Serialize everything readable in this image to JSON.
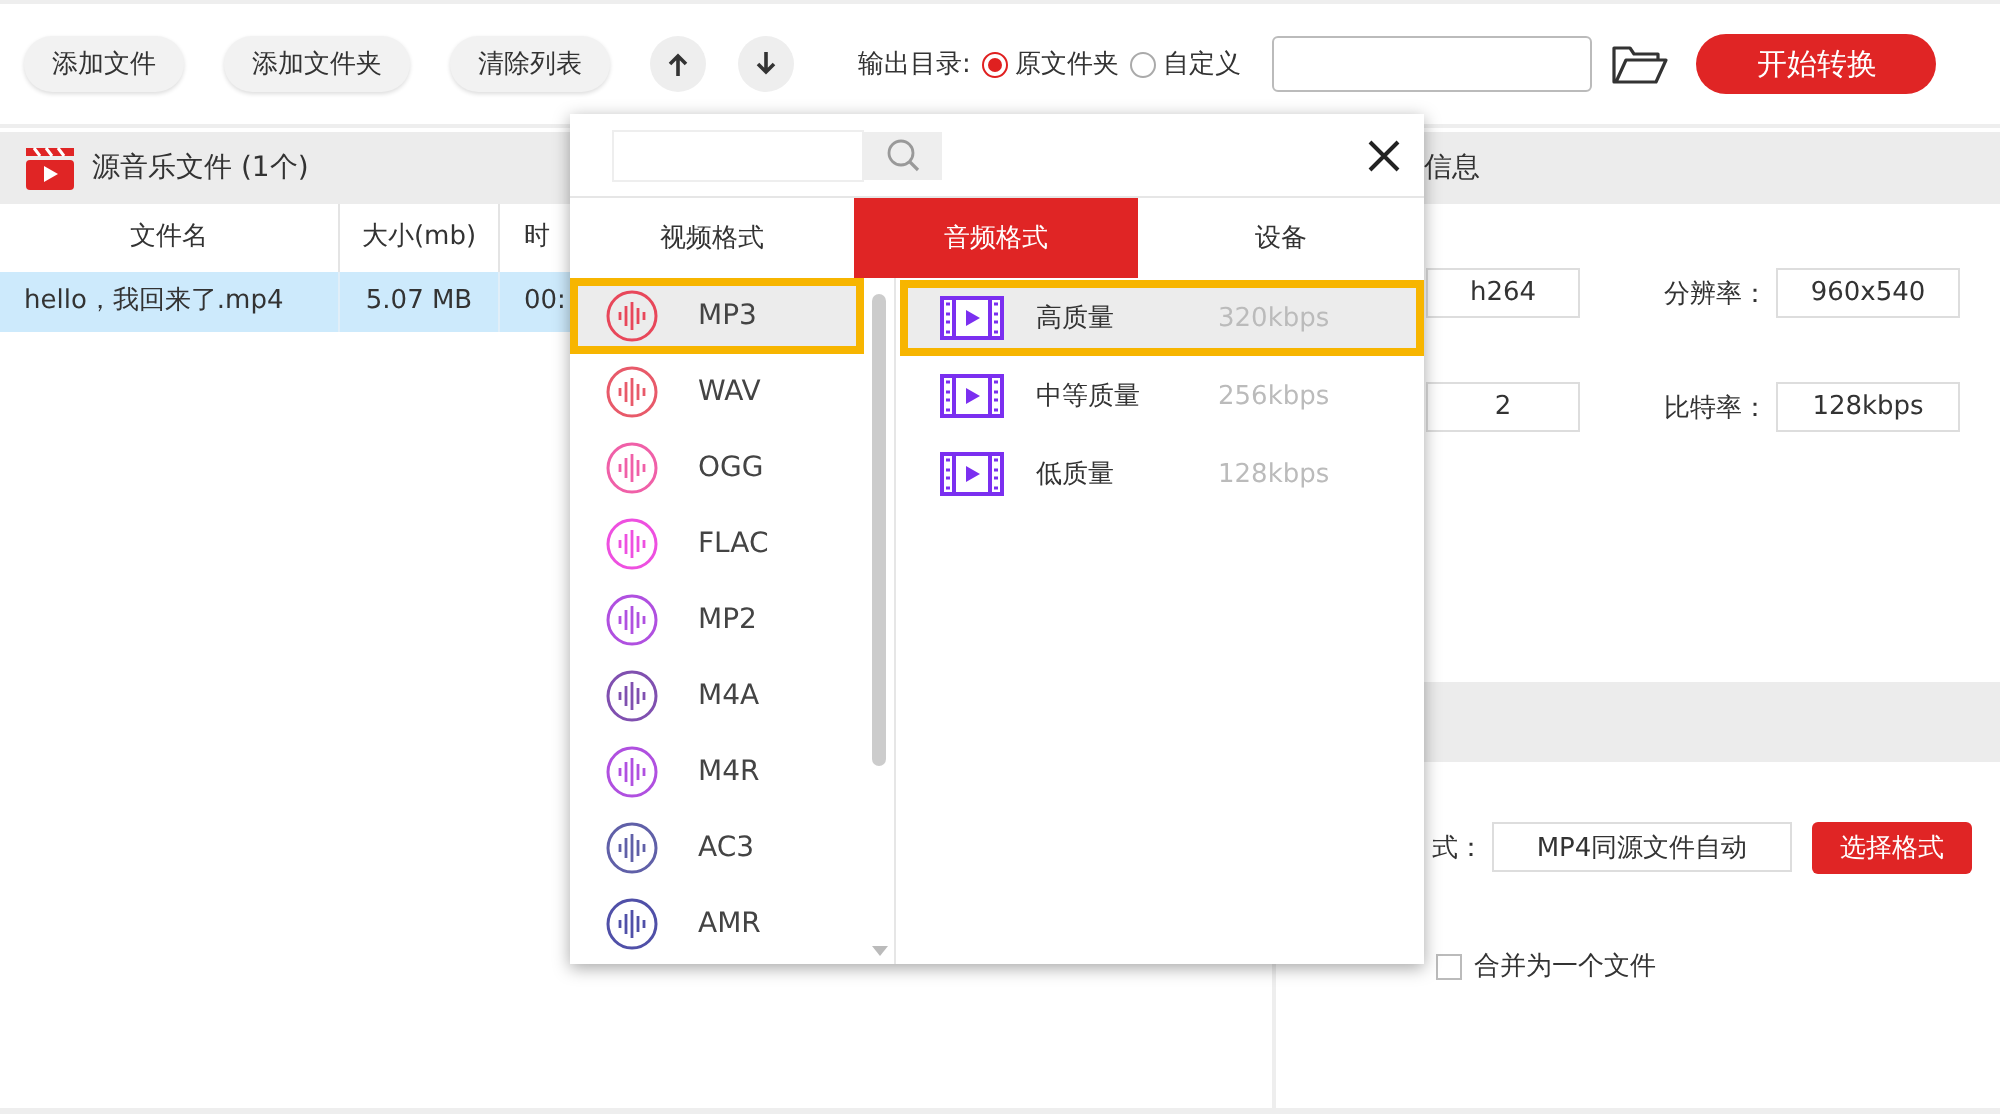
{
  "toolbar": {
    "buttons": [
      {
        "label": "添加文件"
      },
      {
        "label": "添加文件夹"
      },
      {
        "label": "清除列表"
      }
    ],
    "move_buttons": [
      {
        "kind": "up"
      },
      {
        "kind": "down"
      }
    ],
    "output_label": "输出目录:",
    "radios": [
      {
        "label": "原文件夹",
        "selected": true
      },
      {
        "label": "自定义",
        "selected": false
      }
    ],
    "start_button": "开始转换"
  },
  "source_panel": {
    "title": "源音乐文件 (1个)",
    "columns": [
      "文件名",
      "大小(mb)",
      "时"
    ],
    "rows": [
      {
        "cells": [
          "hello，我回来了.mp4",
          "5.07 MB",
          "00:"
        ],
        "selected": true
      }
    ]
  },
  "info_panel": {
    "title": "信息",
    "fields": [
      {
        "value": "h264",
        "label": "分辨率：",
        "value2": "960x540"
      },
      {
        "value": "2",
        "label": "比特率：",
        "value2": "128kbps"
      }
    ],
    "format_label": "式：",
    "format_value": "MP4同源文件自动",
    "format_button": "选择格式",
    "merge": {
      "label": "合并为一个文件",
      "checked": false
    }
  },
  "popup": {
    "tabs": [
      {
        "label": "视频格式",
        "selected": false
      },
      {
        "label": "音频格式",
        "selected": true
      },
      {
        "label": "设备",
        "selected": false
      }
    ],
    "formats": [
      {
        "label": "MP3",
        "color": "#e8475a",
        "selected": true
      },
      {
        "label": "WAV",
        "color": "#e85a6a",
        "selected": false
      },
      {
        "label": "OGG",
        "color": "#f060a8",
        "selected": false
      },
      {
        "label": "FLAC",
        "color": "#ee50e0",
        "selected": false
      },
      {
        "label": "MP2",
        "color": "#b050e0",
        "selected": false
      },
      {
        "label": "M4A",
        "color": "#8050b0",
        "selected": false
      },
      {
        "label": "M4R",
        "color": "#b050e0",
        "selected": false
      },
      {
        "label": "AC3",
        "color": "#6060a8",
        "selected": false
      },
      {
        "label": "AMR",
        "color": "#5050a8",
        "selected": false
      }
    ],
    "qualities": [
      {
        "name": "高质量",
        "bitrate": "320kbps",
        "selected": true
      },
      {
        "name": "中等质量",
        "bitrate": "256kbps",
        "selected": false
      },
      {
        "name": "低质量",
        "bitrate": "128kbps",
        "selected": false
      }
    ]
  }
}
